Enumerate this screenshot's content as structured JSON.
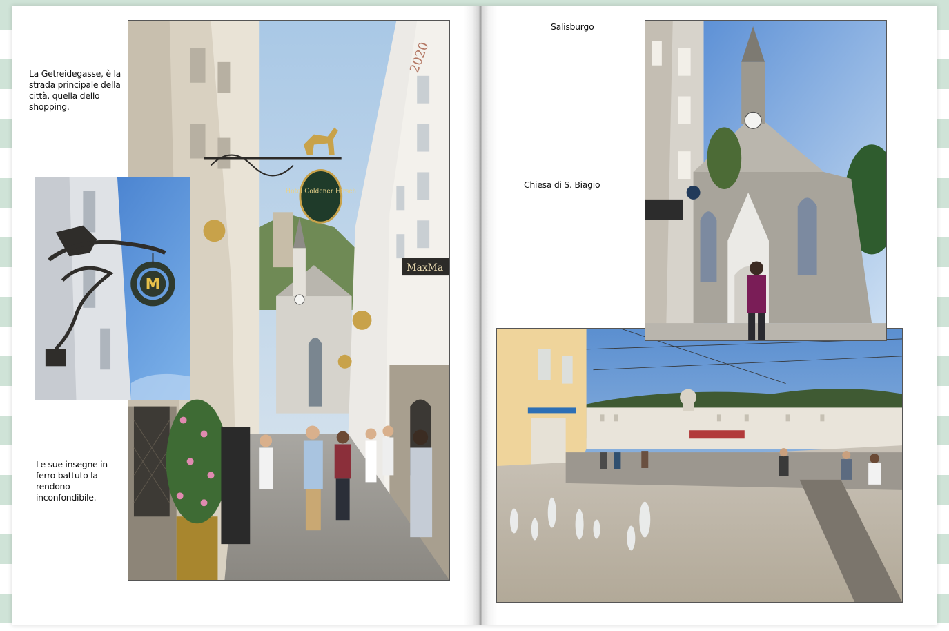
{
  "left_page": {
    "caption_top": "La Getreidegasse, è la strada principale della città, quella dello shopping.",
    "caption_bottom": "Le sue insegne in ferro battuto la rendono inconfondibile.",
    "photo_street": {
      "sign_hotel": "Hotel Goldener Hirsch",
      "sign_shop": "MaxMa",
      "sign_year": "2020"
    },
    "photo_sign": {
      "sign_logo": "M"
    }
  },
  "right_page": {
    "title": "Salisburgo",
    "caption_church": "Chiesa di S. Biagio",
    "photo_church": {},
    "photo_square": {}
  },
  "colors": {
    "page": "#ffffff",
    "stripe": "#cfe3d7",
    "photo_border": "#555555",
    "sky": "#9cc3e8"
  }
}
